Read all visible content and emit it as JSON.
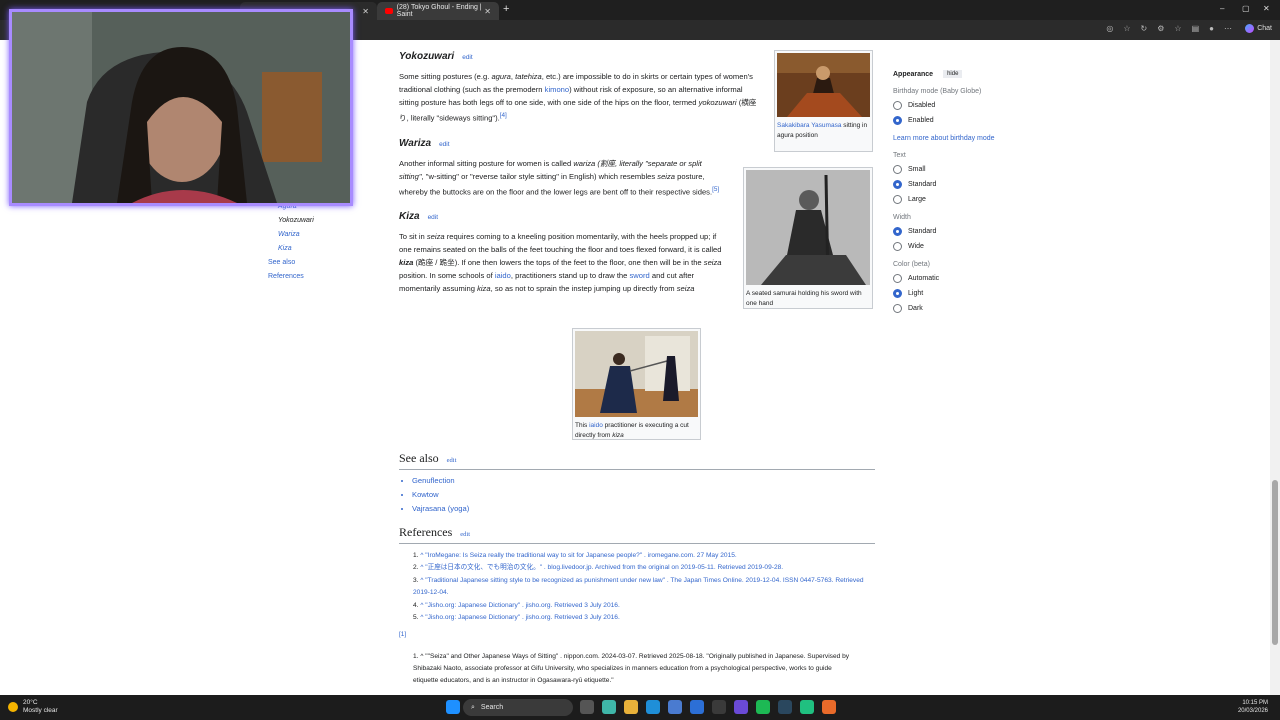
{
  "browser": {
    "tabs": [
      {
        "label": ""
      },
      {
        "label": "(28) Tokyo Ghoul - Ending | Saint"
      }
    ],
    "new_tab": "+",
    "chat_label": "Chat",
    "window_controls": [
      "–",
      "▢",
      "✕"
    ]
  },
  "toc": {
    "items": [
      {
        "label": "Agura",
        "sub": true
      },
      {
        "label": "Yokozuwari",
        "sub": true,
        "current": true
      },
      {
        "label": "Wariza",
        "sub": true
      },
      {
        "label": "Kiza",
        "sub": true
      },
      {
        "label": "See also",
        "sub": false
      },
      {
        "label": "References",
        "sub": false
      }
    ]
  },
  "article": {
    "edit_label": "edit",
    "yokozuwari": {
      "title": "Yokozuwari",
      "p1": "Some sitting postures (e.g. ",
      "agura": "agura",
      "tatehiza": "tatehiza",
      "p2": ", etc.) are impossible to do in skirts or certain types of women's traditional clothing (such as the premodern ",
      "kimono": "kimono",
      "p3": ") without risk of exposure, so an alternative informal sitting posture has both legs off to one side, with one side of the hips on the floor, termed ",
      "term": "yokozuwari",
      "p4": " (横座り, literally \"sideways sitting\").",
      "ref": "[4]"
    },
    "wariza": {
      "title": "Wariza",
      "p1": "Another informal sitting posture for women is called ",
      "term": "wariza",
      "p2": " (割座, literally \"separate or split sitting\"",
      "p3": ", \"w-sitting\" or \"reverse tailor style sitting\" in English) which resembles ",
      "seiza": "seiza",
      "p4": " posture, whereby the buttocks are on the floor and the lower legs are bent off to their respective sides.",
      "ref": "[5]"
    },
    "kiza": {
      "title": "Kiza",
      "text_a": "To sit in ",
      "seiza": "seiza",
      "text_b": " requires coming to a kneeling position momentarily, with the heels propped up; if one remains seated on the balls of the feet touching the floor and toes flexed forward, it is called ",
      "kiza": "kiza",
      "text_c": " (跪座 / 跪坐). If one then lowers the tops of the feet to the floor, one then will be in the ",
      "text_d": " position. In some schools of ",
      "iaido": "iaido",
      "text_e": ", practitioners stand up to draw the ",
      "sword": "sword",
      "text_f": " and cut after momentarily assuming ",
      "text_g": ", so as not to sprain the instep jumping up directly from ",
      "text_h": "seiza"
    },
    "see_also": {
      "title": "See also",
      "items": [
        "Genuflection",
        "Kowtow",
        "Vajrasana (yoga)"
      ]
    },
    "references": {
      "title": "References",
      "items": [
        {
          "n": "1.",
          "text": "^ \"IroMegane: Is Seiza really the traditional way to sit for Japanese people?\" . iromegane.com. 27 May 2015."
        },
        {
          "n": "2.",
          "text": "^ \"正座は日本の文化、でも明治の文化。\" . blog.livedoor.jp. Archived from the original on 2019-05-11. Retrieved 2019-09-28."
        },
        {
          "n": "3.",
          "text": "^ \"Traditional Japanese sitting style to be recognized as punishment under new law\" . The Japan Times Online. 2019-12-04. ISSN 0447-5763. Retrieved 2019-12-04."
        },
        {
          "n": "4.",
          "text": "^ \"Jisho.org: Japanese Dictionary\" . jisho.org. Retrieved 3 July 2016."
        },
        {
          "n": "5.",
          "text": "^ \"Jisho.org: Japanese Dictionary\" . jisho.org. Retrieved 3 July 2016."
        }
      ],
      "note_marker": "[1]",
      "note": {
        "n": "1.",
        "text": "^ \"\"Seiza\" and Other Japanese Ways of Sitting\" . nippon.com. 2024-03-07. Retrieved 2025-08-18. \"Originally published in Japanese. Supervised by Shibazaki Naoto, associate professor at Gifu University, who specializes in manners education from a psychological perspective, works to guide etiquette educators, and is an instructor in Ogasawara-ryū etiquette.\""
      }
    },
    "captions": {
      "yasumasa_link": "Sakakibara Yasumasa",
      "yasumasa_rest": "sitting in agura position",
      "samurai": "A seated samurai holding his sword with one hand",
      "iaido_a": "This ",
      "iaido_link": "iaido",
      "iaido_b": " practitioner is executing a cut directly from ",
      "iaido_c": "kiza"
    }
  },
  "appearance": {
    "title": "Appearance",
    "hide": "hide",
    "birthday_label": "Birthday mode (Baby Globe)",
    "birthday_options": [
      {
        "label": "Disabled",
        "on": false
      },
      {
        "label": "Enabled",
        "on": true
      }
    ],
    "birthday_link": "Learn more about birthday mode",
    "text_label": "Text",
    "text_options": [
      {
        "label": "Small",
        "on": false
      },
      {
        "label": "Standard",
        "on": true
      },
      {
        "label": "Large",
        "on": false
      }
    ],
    "width_label": "Width",
    "width_options": [
      {
        "label": "Standard",
        "on": true
      },
      {
        "label": "Wide",
        "on": false
      }
    ],
    "color_label": "Color (beta)",
    "color_options": [
      {
        "label": "Automatic",
        "on": false
      },
      {
        "label": "Light",
        "on": true
      },
      {
        "label": "Dark",
        "on": false
      }
    ]
  },
  "taskbar": {
    "temp": "20°C",
    "weather": "Mostly clear",
    "search": "Search",
    "time": "10:15 PM",
    "date": "20/03/2026"
  }
}
